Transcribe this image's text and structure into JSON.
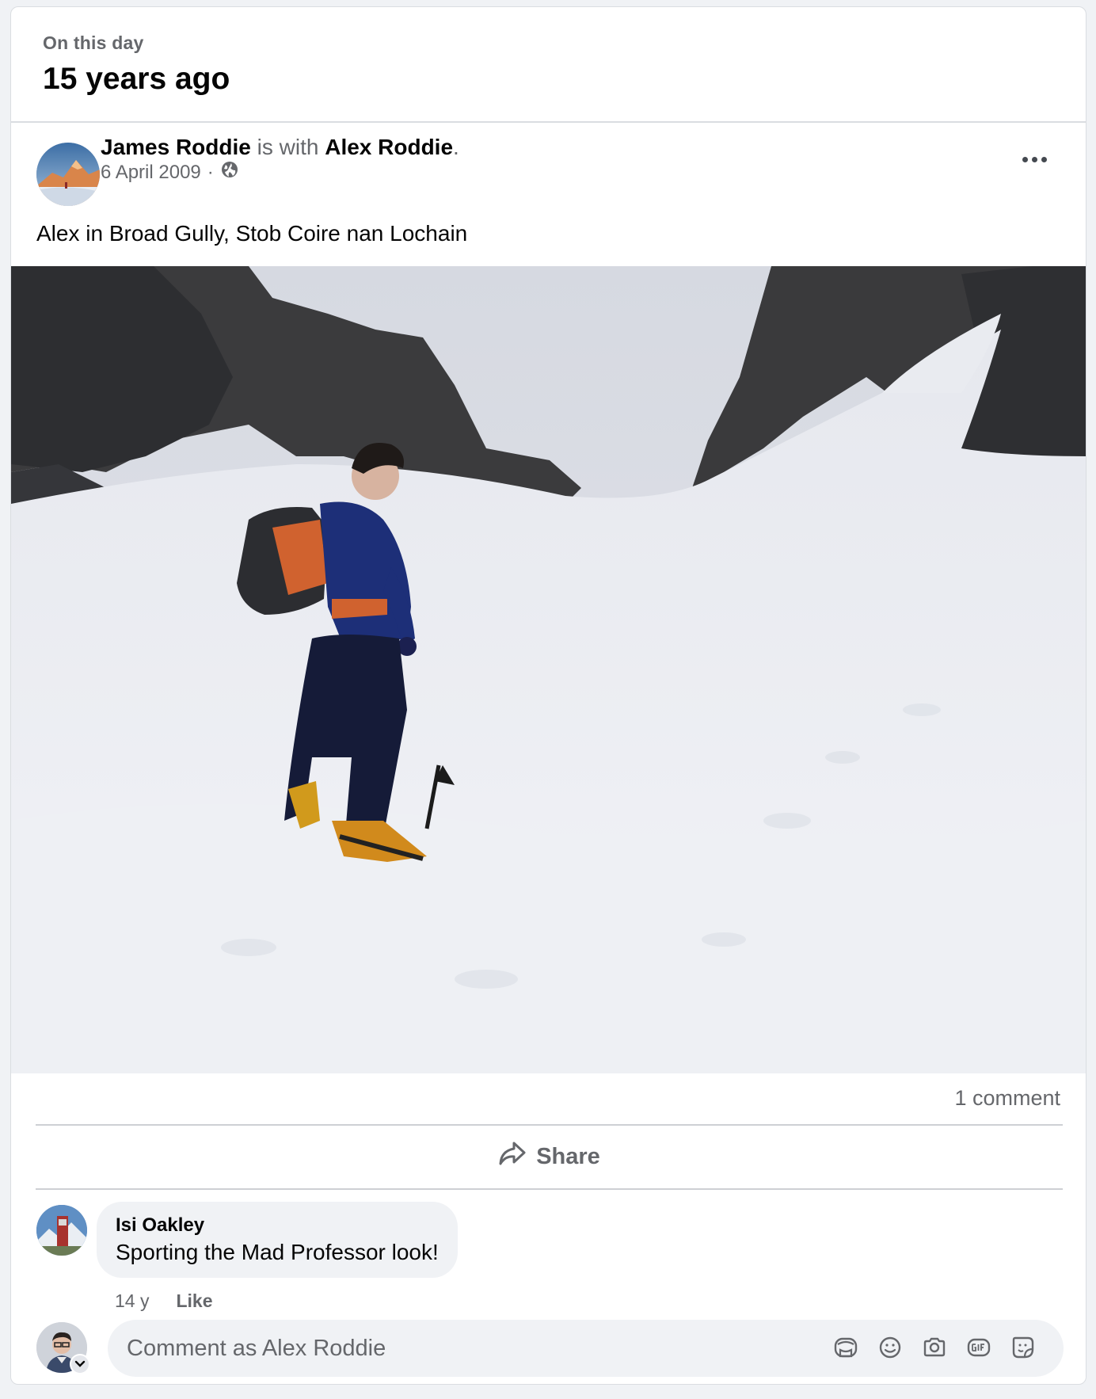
{
  "memory": {
    "eyebrow": "On this day",
    "title": "15 years ago"
  },
  "post": {
    "author": "James Roddie",
    "with_text": "is with",
    "tagged": "Alex Roddie",
    "period": ".",
    "date": "6 April 2009",
    "separator": "·",
    "audience_icon": "globe-icon",
    "caption": "Alex in Broad Gully, Stob Coire nan Lochain",
    "comment_count": "1 comment",
    "share_label": "Share"
  },
  "comment": {
    "author": "Isi Oakley",
    "text": "Sporting the Mad Professor look!",
    "age": "14 y",
    "like_label": "Like"
  },
  "composer": {
    "placeholder": "Comment as Alex Roddie",
    "icons": [
      "avatar-sticker-icon",
      "emoji-icon",
      "camera-icon",
      "gif-icon",
      "sticker-icon"
    ]
  },
  "colors": {
    "background": "#f0f2f5",
    "secondary_text": "#65676b",
    "primary_text": "#050505"
  }
}
